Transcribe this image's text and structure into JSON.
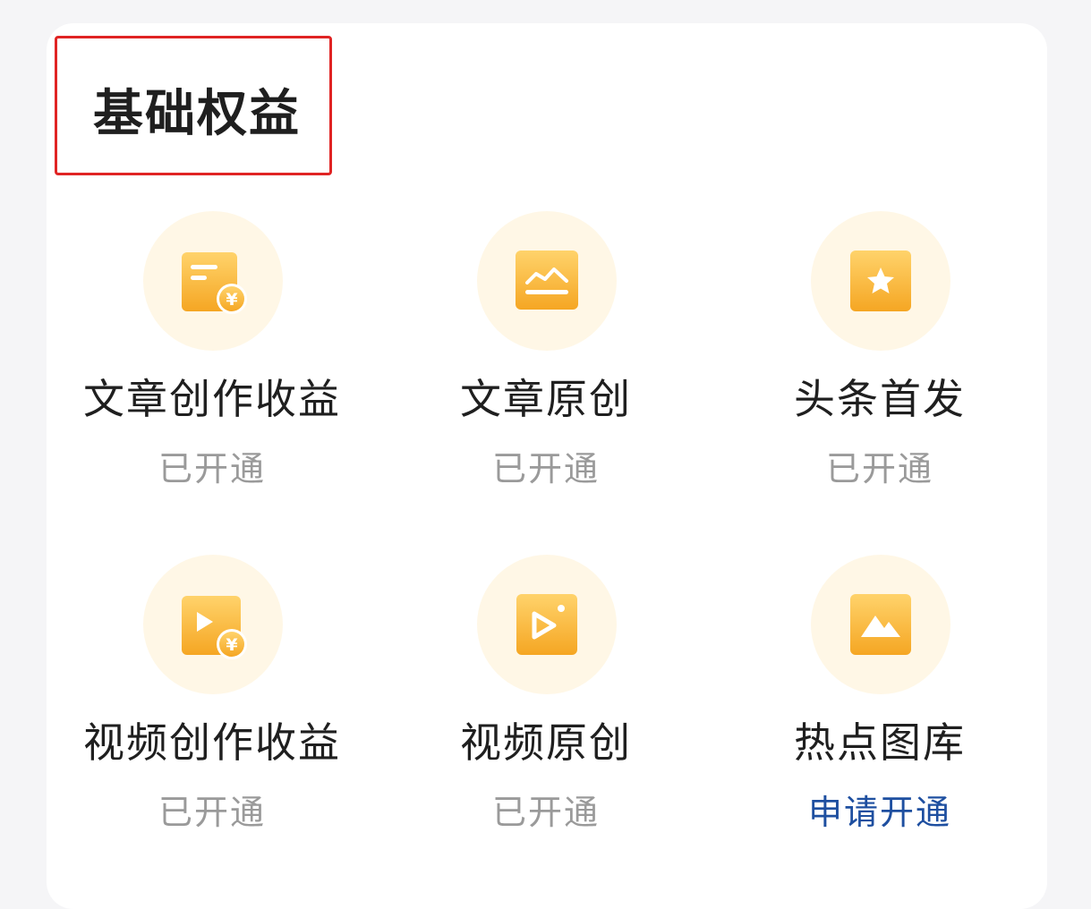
{
  "section": {
    "title": "基础权益"
  },
  "benefits": [
    {
      "name": "文章创作收益",
      "status": "已开通",
      "icon": "article-revenue-icon"
    },
    {
      "name": "文章原创",
      "status": "已开通",
      "icon": "article-chart-icon"
    },
    {
      "name": "头条首发",
      "status": "已开通",
      "icon": "star-icon"
    },
    {
      "name": "视频创作收益",
      "status": "已开通",
      "icon": "video-revenue-icon"
    },
    {
      "name": "视频原创",
      "status": "已开通",
      "icon": "video-play-icon"
    },
    {
      "name": "热点图库",
      "status": "申请开通",
      "icon": "mountain-image-icon"
    }
  ],
  "colors": {
    "icon_gradient_top": "#ffd36b",
    "icon_gradient_bottom": "#f5a623",
    "icon_circle_bg": "#fff7e6",
    "status_text": "#9a9a9a",
    "action_text": "#1e4fa0",
    "highlight_border": "#e02424"
  }
}
